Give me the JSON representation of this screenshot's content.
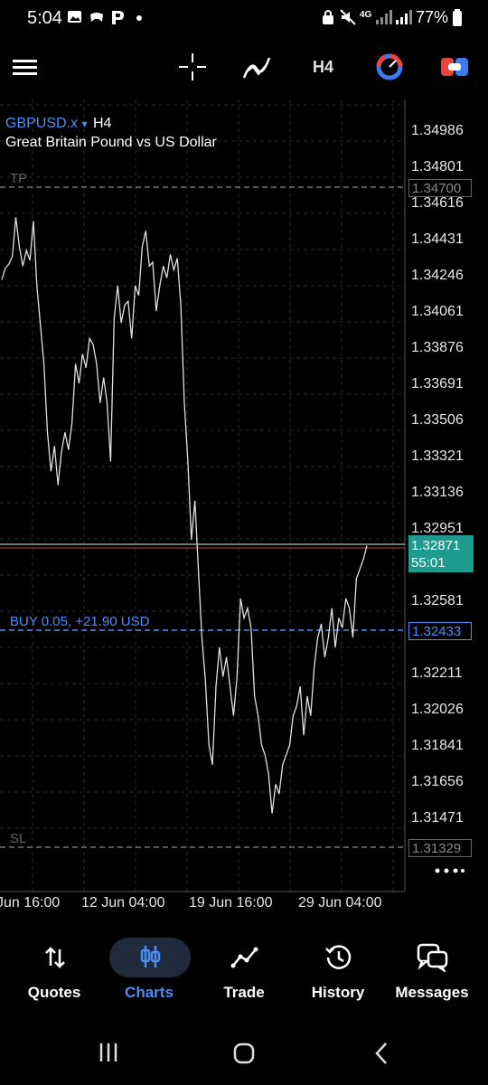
{
  "status_bar": {
    "time": "5:04",
    "battery": "77%",
    "signal_label": "4G"
  },
  "toolbar": {
    "menu_icon": "hamburger-menu-icon",
    "crosshair_icon": "crosshair-icon",
    "indicators_icon": "indicators-icon",
    "timeframe": "H4",
    "objects_icon": "objects-icon",
    "trade_icon": "trade-panel-icon"
  },
  "chart": {
    "symbol": "GBPUSD.x",
    "symbol_caret": "▾",
    "timeframe": "H4",
    "description": "Great Britain Pound vs US Dollar",
    "price_labels": [
      "1.34986",
      "1.34801",
      "1.34616",
      "1.34431",
      "1.34246",
      "1.34061",
      "1.33876",
      "1.33691",
      "1.33506",
      "1.33321",
      "1.33136",
      "1.32951",
      "1.32581",
      "1.32211",
      "1.32026",
      "1.31841",
      "1.31656",
      "1.31471"
    ],
    "date_labels": [
      "Jun 16:00",
      "12 Jun 04:00",
      "19 Jun 16:00",
      "29 Jun 04:00"
    ],
    "tp_label": "TP",
    "tp_price": "1.34700",
    "sl_label": "SL",
    "sl_price": "1.31329",
    "position_label": "BUY 0.05,   +21.90 USD",
    "position_price": "1.32433",
    "current_price": "1.32871",
    "countdown": "55:01",
    "more_icon": "more-dots-icon"
  },
  "chart_data": {
    "type": "line",
    "ylim": [
      1.313,
      1.3505
    ],
    "y": [
      1.3423,
      1.3429,
      1.3431,
      1.3435,
      1.3455,
      1.344,
      1.343,
      1.3438,
      1.3433,
      1.3453,
      1.342,
      1.34,
      1.338,
      1.3345,
      1.3325,
      1.3338,
      1.3318,
      1.3335,
      1.3345,
      1.3336,
      1.335,
      1.338,
      1.337,
      1.3385,
      1.3378,
      1.3393,
      1.339,
      1.338,
      1.336,
      1.3373,
      1.336,
      1.333,
      1.3403,
      1.342,
      1.3401,
      1.341,
      1.3412,
      1.3393,
      1.342,
      1.3415,
      1.344,
      1.3448,
      1.343,
      1.3432,
      1.3407,
      1.342,
      1.343,
      1.3424,
      1.3436,
      1.3428,
      1.3434,
      1.341,
      1.336,
      1.333,
      1.329,
      1.331,
      1.3275,
      1.324,
      1.3218,
      1.3185,
      1.3175,
      1.3215,
      1.3235,
      1.322,
      1.323,
      1.3215,
      1.32,
      1.322,
      1.326,
      1.325,
      1.3255,
      1.3245,
      1.321,
      1.32,
      1.3185,
      1.318,
      1.317,
      1.315,
      1.3165,
      1.316,
      1.3175,
      1.318,
      1.3185,
      1.32,
      1.3205,
      1.3215,
      1.319,
      1.321,
      1.32,
      1.3225,
      1.324,
      1.3247,
      1.323,
      1.324,
      1.3255,
      1.3235,
      1.325,
      1.3245,
      1.326,
      1.3255,
      1.324,
      1.327,
      1.3275,
      1.328,
      1.3287
    ]
  },
  "bottom_nav": {
    "items": [
      {
        "label": "Quotes",
        "icon": "quotes-arrows-icon"
      },
      {
        "label": "Charts",
        "icon": "charts-candles-icon"
      },
      {
        "label": "Trade",
        "icon": "trade-line-icon"
      },
      {
        "label": "History",
        "icon": "history-clock-icon"
      },
      {
        "label": "Messages",
        "icon": "messages-icon"
      }
    ]
  },
  "system_nav": {
    "recents_icon": "recents-icon",
    "home_icon": "home-icon",
    "back_icon": "back-icon"
  },
  "colors": {
    "accent": "#4a8ff7",
    "current_price_bg": "#1e9a8e",
    "grid": "#2a2a2a"
  }
}
